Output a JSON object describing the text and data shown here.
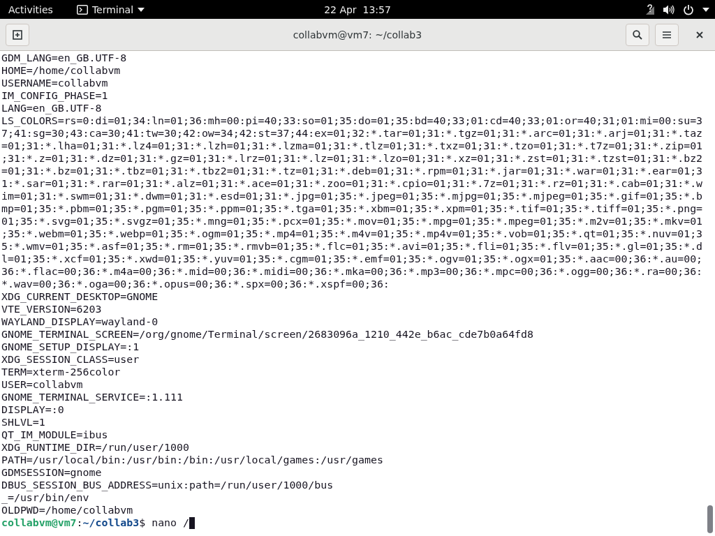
{
  "top_bar": {
    "activities": "Activities",
    "app_menu": "Terminal",
    "clock": "22 Apr  13:57"
  },
  "window": {
    "title": "collabvm@vm7: ~/collab3"
  },
  "terminal": {
    "lines": [
      "GDM_LANG=en_GB.UTF-8",
      "HOME=/home/collabvm",
      "USERNAME=collabvm",
      "IM_CONFIG_PHASE=1",
      "LANG=en_GB.UTF-8",
      "LS_COLORS=rs=0:di=01;34:ln=01;36:mh=00:pi=40;33:so=01;35:do=01;35:bd=40;33;01:cd=40;33;01:or=40;31;01:mi=00:su=3",
      "7;41:sg=30;43:ca=30;41:tw=30;42:ow=34;42:st=37;44:ex=01;32:*.tar=01;31:*.tgz=01;31:*.arc=01;31:*.arj=01;31:*.taz",
      "=01;31:*.lha=01;31:*.lz4=01;31:*.lzh=01;31:*.lzma=01;31:*.tlz=01;31:*.txz=01;31:*.tzo=01;31:*.t7z=01;31:*.zip=01",
      ";31:*.z=01;31:*.dz=01;31:*.gz=01;31:*.lrz=01;31:*.lz=01;31:*.lzo=01;31:*.xz=01;31:*.zst=01;31:*.tzst=01;31:*.bz2",
      "=01;31:*.bz=01;31:*.tbz=01;31:*.tbz2=01;31:*.tz=01;31:*.deb=01;31:*.rpm=01;31:*.jar=01;31:*.war=01;31:*.ear=01;3",
      "1:*.sar=01;31:*.rar=01;31:*.alz=01;31:*.ace=01;31:*.zoo=01;31:*.cpio=01;31:*.7z=01;31:*.rz=01;31:*.cab=01;31:*.w",
      "im=01;31:*.swm=01;31:*.dwm=01;31:*.esd=01;31:*.jpg=01;35:*.jpeg=01;35:*.mjpg=01;35:*.mjpeg=01;35:*.gif=01;35:*.b",
      "mp=01;35:*.pbm=01;35:*.pgm=01;35:*.ppm=01;35:*.tga=01;35:*.xbm=01;35:*.xpm=01;35:*.tif=01;35:*.tiff=01;35:*.png=",
      "01;35:*.svg=01;35:*.svgz=01;35:*.mng=01;35:*.pcx=01;35:*.mov=01;35:*.mpg=01;35:*.mpeg=01;35:*.m2v=01;35:*.mkv=01",
      ";35:*.webm=01;35:*.webp=01;35:*.ogm=01;35:*.mp4=01;35:*.m4v=01;35:*.mp4v=01;35:*.vob=01;35:*.qt=01;35:*.nuv=01;3",
      "5:*.wmv=01;35:*.asf=01;35:*.rm=01;35:*.rmvb=01;35:*.flc=01;35:*.avi=01;35:*.fli=01;35:*.flv=01;35:*.gl=01;35:*.d",
      "l=01;35:*.xcf=01;35:*.xwd=01;35:*.yuv=01;35:*.cgm=01;35:*.emf=01;35:*.ogv=01;35:*.ogx=01;35:*.aac=00;36:*.au=00;",
      "36:*.flac=00;36:*.m4a=00;36:*.mid=00;36:*.midi=00;36:*.mka=00;36:*.mp3=00;36:*.mpc=00;36:*.ogg=00;36:*.ra=00;36:",
      "*.wav=00;36:*.oga=00;36:*.opus=00;36:*.spx=00;36:*.xspf=00;36:",
      "XDG_CURRENT_DESKTOP=GNOME",
      "VTE_VERSION=6203",
      "WAYLAND_DISPLAY=wayland-0",
      "GNOME_TERMINAL_SCREEN=/org/gnome/Terminal/screen/2683096a_1210_442e_b6ac_cde7b0a64fd8",
      "GNOME_SETUP_DISPLAY=:1",
      "XDG_SESSION_CLASS=user",
      "TERM=xterm-256color",
      "USER=collabvm",
      "GNOME_TERMINAL_SERVICE=:1.111",
      "DISPLAY=:0",
      "SHLVL=1",
      "QT_IM_MODULE=ibus",
      "XDG_RUNTIME_DIR=/run/user/1000",
      "PATH=/usr/local/bin:/usr/bin:/bin:/usr/local/games:/usr/games",
      "GDMSESSION=gnome",
      "DBUS_SESSION_BUS_ADDRESS=unix:path=/run/user/1000/bus",
      "_=/usr/bin/env",
      "OLDPWD=/home/collabvm"
    ],
    "prompt": {
      "user_host": "collabvm@vm7",
      "separator": ":",
      "path": "~/collab3",
      "symbol": "$",
      "command": "nano /"
    }
  }
}
